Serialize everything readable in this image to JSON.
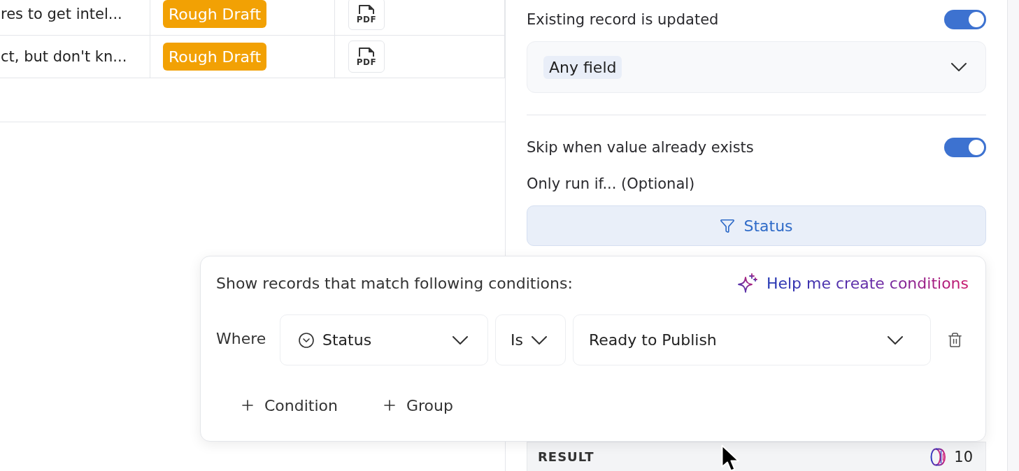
{
  "table": {
    "rows": [
      {
        "column_1": "res to get intel...",
        "status": {
          "label": "Rough Draft",
          "color": "#f2a104"
        },
        "attachment": "PDF"
      },
      {
        "column_1": "ct, but don't kn...",
        "status": {
          "label": "Rough Draft",
          "color": "#f2a104"
        },
        "attachment": "PDF"
      }
    ]
  },
  "panel": {
    "update_toggle": {
      "label": "Existing record is updated",
      "on": true
    },
    "field_select": {
      "chips": [
        "Any field"
      ]
    },
    "skip_toggle": {
      "label": "Skip when value already exists",
      "on": true
    },
    "run_if_label": "Only run if... (Optional)",
    "filter_button": {
      "label": "Status"
    },
    "result": {
      "label": "RESULT",
      "count": "10"
    }
  },
  "filter_popover": {
    "heading": "Show records that match following conditions:",
    "help_link": "Help me create conditions",
    "conditions": [
      {
        "prefix": "Where",
        "field": "Status",
        "operator": "Is",
        "value": "Ready to Publish"
      }
    ],
    "add_buttons": [
      "Condition",
      "Group"
    ]
  }
}
